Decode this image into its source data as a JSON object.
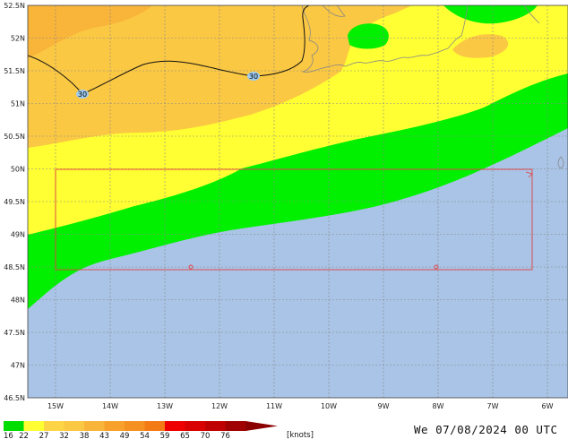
{
  "map": {
    "lat_labels": [
      "52.5N",
      "52N",
      "51.5N",
      "51N",
      "50.5N",
      "50N",
      "49.5N",
      "49N",
      "48.5N",
      "48N",
      "47.5N",
      "47N",
      "46.5N"
    ],
    "lon_labels": [
      "15W",
      "14W",
      "13W",
      "12W",
      "11W",
      "10W",
      "9W",
      "8W",
      "7W",
      "6W"
    ],
    "isoline_label": "30",
    "colors": {
      "sea_calm": "#a9c4e6",
      "green": "#00f000",
      "yellow": "#ffff33",
      "light_orange": "#fbc843",
      "mid_orange": "#f9b43a",
      "land_outline": "#888888",
      "box": "#e24040"
    }
  },
  "legend": {
    "labels": [
      "16",
      "22",
      "27",
      "32",
      "38",
      "43",
      "49",
      "54",
      "59",
      "65",
      "70",
      "76"
    ],
    "unit": "[knots]",
    "colors": [
      "#00dd00",
      "#ffff33",
      "#fcd446",
      "#fbc843",
      "#f9b43a",
      "#f7a12a",
      "#f59120",
      "#f47a16",
      "#ef0000",
      "#d80000",
      "#c00000",
      "#a00000"
    ]
  },
  "timestamp": "We 07/08/2024 00 UTC"
}
